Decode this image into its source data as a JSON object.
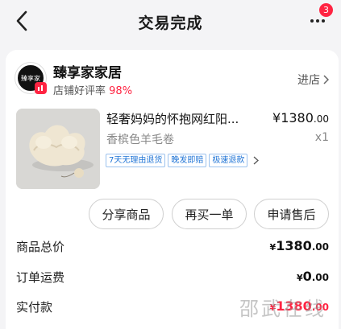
{
  "header": {
    "title": "交易完成",
    "more_badge": "3"
  },
  "shop": {
    "name": "臻享家家居",
    "rating_label": "店铺好评率",
    "rating_value": "98%",
    "enter_label": "进店",
    "avatar_text": "臻享家"
  },
  "product": {
    "title": "轻奢妈妈的怀抱网红阳...",
    "price_symbol": "¥",
    "price_int": "1380",
    "price_dec": ".00",
    "spec": "香槟色羊毛卷",
    "qty": "x1",
    "tags": [
      "7天无理由退货",
      "晚发即赔",
      "极速退款"
    ]
  },
  "actions": {
    "share": "分享商品",
    "rebuy": "再买一单",
    "after_sale": "申请售后"
  },
  "summary": {
    "goods_total_label": "商品总价",
    "goods_total_symbol": "¥",
    "goods_total_int": "1380",
    "goods_total_dec": ".00",
    "shipping_label": "订单运费",
    "shipping_symbol": "¥",
    "shipping_int": "0",
    "shipping_dec": ".00",
    "paid_label": "实付款",
    "paid_symbol": "¥",
    "paid_int": "1380",
    "paid_dec": ".00"
  },
  "watermark": "邵武在线",
  "colors": {
    "accent": "#ff2442",
    "tag_blue": "#1f74d6",
    "background": "#f4f4f6"
  }
}
